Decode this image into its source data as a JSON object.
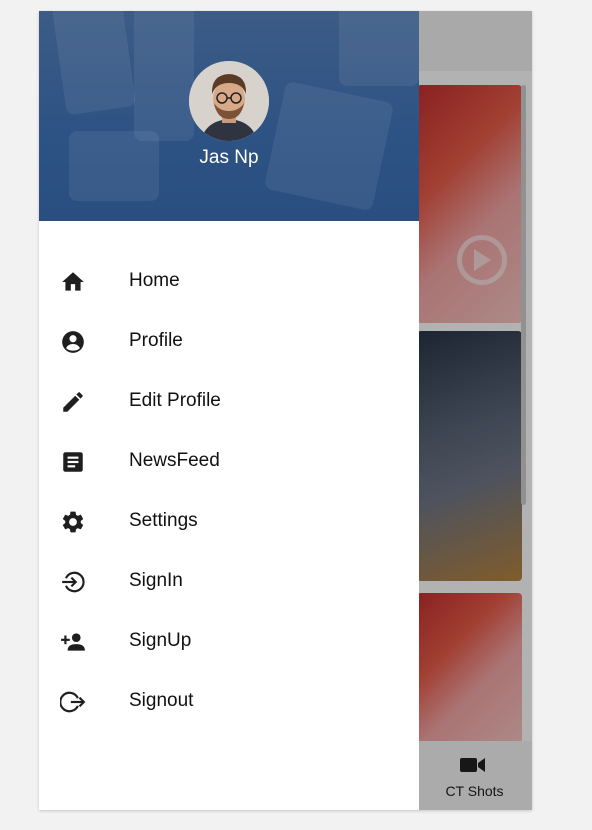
{
  "drawer": {
    "user_name": "Jas Np",
    "items": [
      {
        "label": "Home",
        "icon": "home-icon"
      },
      {
        "label": "Profile",
        "icon": "account-circle-icon"
      },
      {
        "label": "Edit Profile",
        "icon": "pencil-icon"
      },
      {
        "label": "NewsFeed",
        "icon": "article-icon"
      },
      {
        "label": "Settings",
        "icon": "gear-icon"
      },
      {
        "label": "SignIn",
        "icon": "login-icon"
      },
      {
        "label": "SignUp",
        "icon": "person-add-icon"
      },
      {
        "label": "Signout",
        "icon": "logout-icon"
      }
    ]
  },
  "bottom_nav": {
    "visible_tab_label": "CT Shots",
    "visible_tab_icon": "video-camera-icon"
  },
  "colors": {
    "header_blue": "#2d5284",
    "icon_dark": "#1f1f1f"
  }
}
